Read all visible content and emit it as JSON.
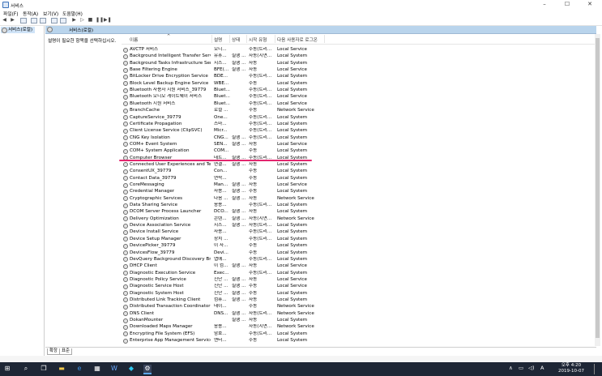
{
  "window": {
    "title": "서비스",
    "minimize": "–",
    "maximize": "☐",
    "close": "✕"
  },
  "menu": [
    "파일(F)",
    "동작(A)",
    "보기(V)",
    "도움말(H)"
  ],
  "tree": {
    "root": "서비스(로컬)"
  },
  "panel": {
    "header": "서비스(로컬)",
    "description": "설명이 필요한 항목을 선택하십시오."
  },
  "columns": {
    "name": "이름",
    "description": "설명",
    "status": "상태",
    "startup": "시작 유형",
    "logon": "다음 사용자로 로그온"
  },
  "services": [
    {
      "name": "AVCTP 서비스",
      "desc": "오디...",
      "status": "",
      "start": "수동(트리...",
      "logon": "Local Service"
    },
    {
      "name": "Background Intelligent Transfer Service",
      "desc": "유휴...",
      "status": "실행 ...",
      "start": "자동(지연...",
      "logon": "Local System"
    },
    {
      "name": "Background Tasks Infrastructure Service",
      "desc": "시스...",
      "status": "실행 ...",
      "start": "자동",
      "logon": "Local System"
    },
    {
      "name": "Base Filtering Engine",
      "desc": "BFE(...",
      "status": "실행 ...",
      "start": "자동",
      "logon": "Local Service"
    },
    {
      "name": "BitLocker Drive Encryption Service",
      "desc": "BDE...",
      "status": "",
      "start": "수동(트리...",
      "logon": "Local System"
    },
    {
      "name": "Block Level Backup Engine Service",
      "desc": "WBE...",
      "status": "",
      "start": "수동",
      "logon": "Local System"
    },
    {
      "name": "Bluetooth 사용자 지원 서비스_39779",
      "desc": "Bluet...",
      "status": "",
      "start": "수동(트리...",
      "logon": "Local System"
    },
    {
      "name": "Bluetooth 오디오 게이트웨이 서비스",
      "desc": "Bluet...",
      "status": "",
      "start": "수동(트리...",
      "logon": "Local Service"
    },
    {
      "name": "Bluetooth 지원 서비스",
      "desc": "Bluet...",
      "status": "",
      "start": "수동(트리...",
      "logon": "Local Service"
    },
    {
      "name": "BranchCache",
      "desc": "로컬 ...",
      "status": "",
      "start": "수동",
      "logon": "Network Service"
    },
    {
      "name": "CaptureService_39779",
      "desc": "One...",
      "status": "",
      "start": "수동(트리...",
      "logon": "Local System"
    },
    {
      "name": "Certificate Propagation",
      "desc": "스마...",
      "status": "",
      "start": "수동(트리...",
      "logon": "Local System"
    },
    {
      "name": "Client License Service (ClipSVC)",
      "desc": "Micr...",
      "status": "",
      "start": "수동(트리...",
      "logon": "Local System"
    },
    {
      "name": "CNG Key Isolation",
      "desc": "CNG...",
      "status": "실행 ...",
      "start": "수동(트리...",
      "logon": "Local System"
    },
    {
      "name": "COM+ Event System",
      "desc": "SEN...",
      "status": "실행 ...",
      "start": "자동",
      "logon": "Local Service"
    },
    {
      "name": "COM+ System Application",
      "desc": "COM...",
      "status": "",
      "start": "수동",
      "logon": "Local System"
    },
    {
      "name": "Computer Browser",
      "desc": "네트...",
      "status": "실행 ...",
      "start": "수동(트리...",
      "logon": "Local System"
    },
    {
      "name": "Connected User Experiences and Teleme...",
      "desc": "연결...",
      "status": "실행 ...",
      "start": "자동",
      "logon": "Local System"
    },
    {
      "name": "ConsentUX_39779",
      "desc": "Con...",
      "status": "",
      "start": "수동",
      "logon": "Local System"
    },
    {
      "name": "Contact Data_39779",
      "desc": "연락...",
      "status": "",
      "start": "수동",
      "logon": "Local System"
    },
    {
      "name": "CoreMessaging",
      "desc": "Man...",
      "status": "실행 ...",
      "start": "자동",
      "logon": "Local Service"
    },
    {
      "name": "Credential Manager",
      "desc": "사용...",
      "status": "실행 ...",
      "start": "수동",
      "logon": "Local System"
    },
    {
      "name": "Cryptographic Services",
      "desc": "다음 ...",
      "status": "실행 ...",
      "start": "자동",
      "logon": "Network Service"
    },
    {
      "name": "Data Sharing Service",
      "desc": "응용...",
      "status": "",
      "start": "수동(트리...",
      "logon": "Local System"
    },
    {
      "name": "DCOM Server Process Launcher",
      "desc": "DCO...",
      "status": "실행 ...",
      "start": "자동",
      "logon": "Local System"
    },
    {
      "name": "Delivery Optimization",
      "desc": "콘텐...",
      "status": "실행 ...",
      "start": "자동(지연...",
      "logon": "Network Service"
    },
    {
      "name": "Device Association Service",
      "desc": "시스...",
      "status": "실행 ...",
      "start": "자동(트리...",
      "logon": "Local System"
    },
    {
      "name": "Device Install Service",
      "desc": "사용...",
      "status": "",
      "start": "수동(트리...",
      "logon": "Local System"
    },
    {
      "name": "Device Setup Manager",
      "desc": "장치 ...",
      "status": "",
      "start": "수동(트리...",
      "logon": "Local System"
    },
    {
      "name": "DevicePicker_39779",
      "desc": "이 사...",
      "status": "",
      "start": "수동",
      "logon": "Local System"
    },
    {
      "name": "DevicesFlow_39779",
      "desc": "Devi...",
      "status": "",
      "start": "수동",
      "logon": "Local System"
    },
    {
      "name": "DevQuery Background Discovery Broker",
      "desc": "앱에...",
      "status": "",
      "start": "수동(트리...",
      "logon": "Local System"
    },
    {
      "name": "DHCP Client",
      "desc": "이 컴...",
      "status": "실행 ...",
      "start": "자동",
      "logon": "Local Service"
    },
    {
      "name": "Diagnostic Execution Service",
      "desc": "Exec...",
      "status": "",
      "start": "수동(트리...",
      "logon": "Local System"
    },
    {
      "name": "Diagnostic Policy Service",
      "desc": "진단 ...",
      "status": "실행 ...",
      "start": "자동",
      "logon": "Local Service"
    },
    {
      "name": "Diagnostic Service Host",
      "desc": "진단 ...",
      "status": "실행 ...",
      "start": "수동",
      "logon": "Local Service"
    },
    {
      "name": "Diagnostic System Host",
      "desc": "진단 ...",
      "status": "실행 ...",
      "start": "수동",
      "logon": "Local System"
    },
    {
      "name": "Distributed Link Tracking Client",
      "desc": "컴퓨...",
      "status": "실행 ...",
      "start": "자동",
      "logon": "Local System"
    },
    {
      "name": "Distributed Transaction Coordinator",
      "desc": "데이...",
      "status": "",
      "start": "수동",
      "logon": "Network Service"
    },
    {
      "name": "DNS Client",
      "desc": "DNS...",
      "status": "실행 ...",
      "start": "자동(트리...",
      "logon": "Network Service"
    },
    {
      "name": "DokanMounter",
      "desc": "",
      "status": "실행 ...",
      "start": "자동",
      "logon": "Local System"
    },
    {
      "name": "Downloaded Maps Manager",
      "desc": "응용...",
      "status": "",
      "start": "자동(지연...",
      "logon": "Network Service"
    },
    {
      "name": "Encrypting File System (EFS)",
      "desc": "암호...",
      "status": "",
      "start": "수동(트리...",
      "logon": "Local System"
    },
    {
      "name": "Enterprise App Management Service",
      "desc": "엔터...",
      "status": "",
      "start": "수동",
      "logon": "Local System"
    }
  ],
  "tabs": [
    "확장",
    "표준"
  ],
  "taskbar": {
    "time": "오후 4:20",
    "date": "2019-10-07",
    "ime": "A"
  }
}
